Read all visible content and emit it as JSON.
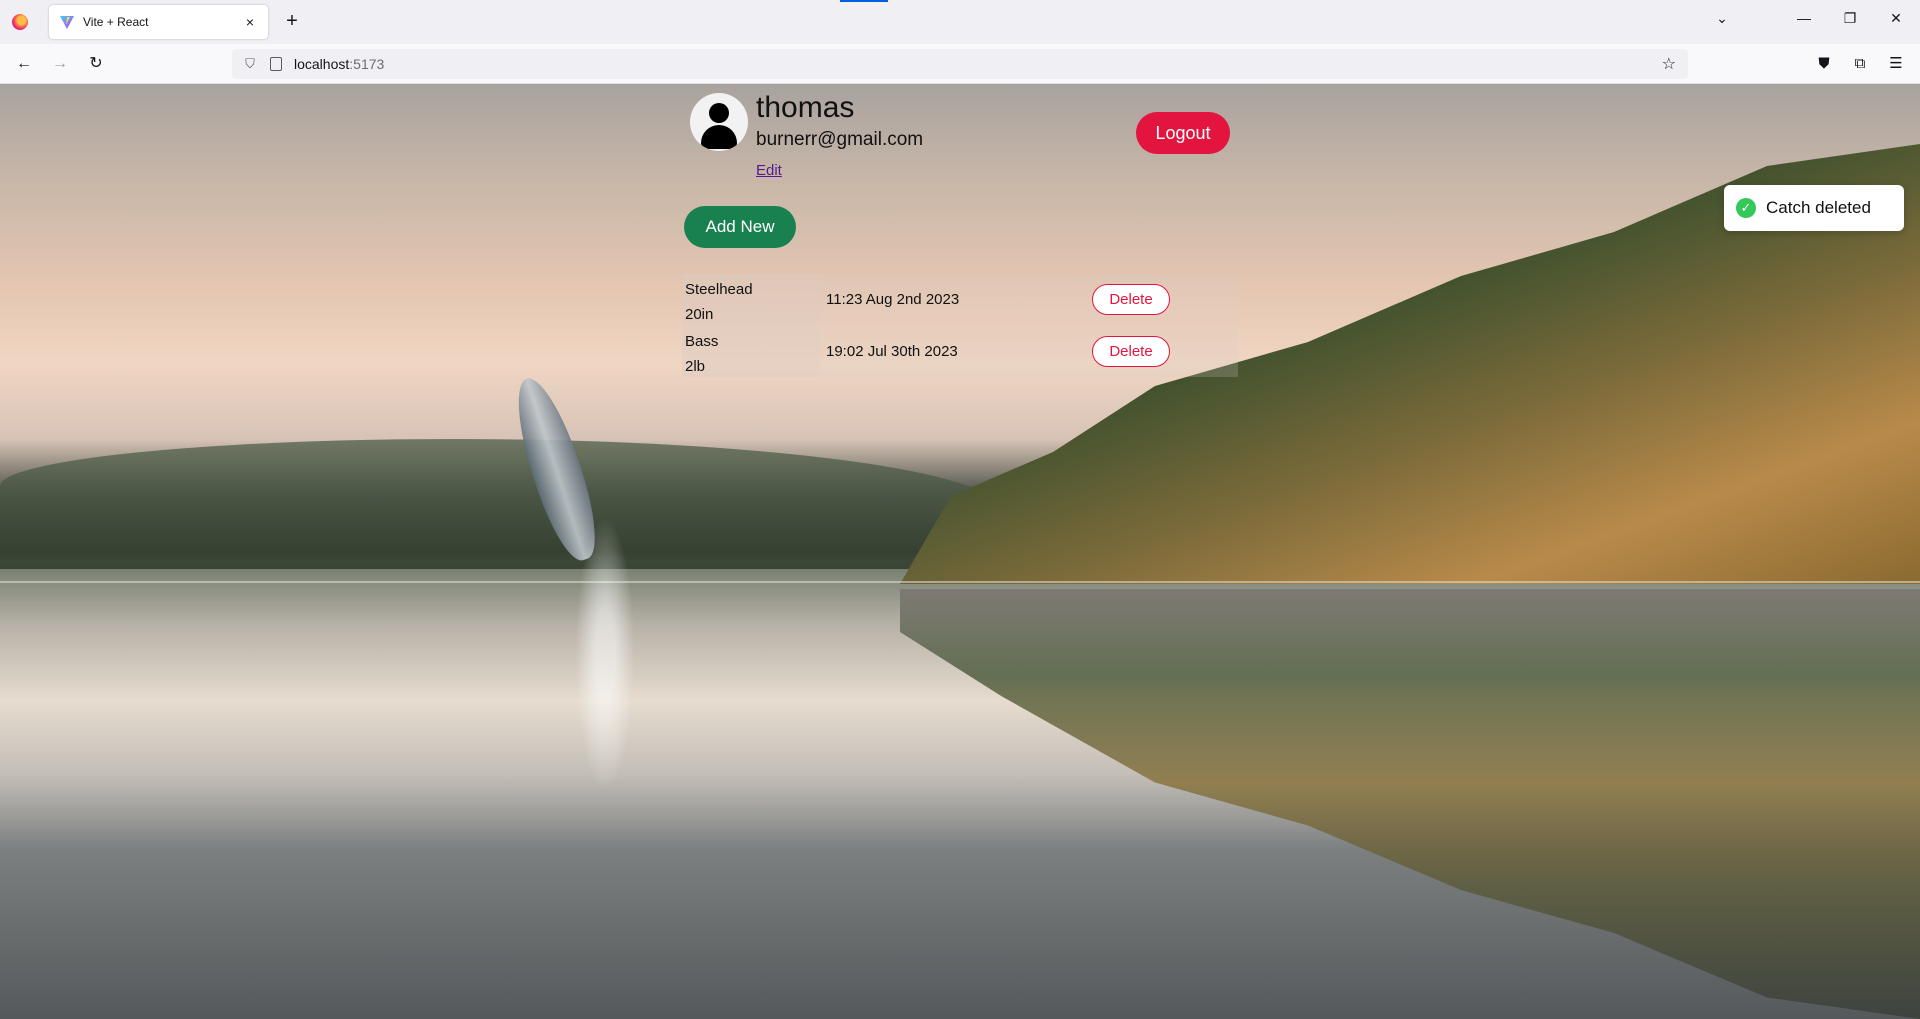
{
  "browser": {
    "tab_title": "Vite + React",
    "tab_close": "×",
    "new_tab": "+",
    "url_host": "localhost",
    "url_port": ":5173"
  },
  "profile": {
    "username": "thomas",
    "email": "burnerr@gmail.com",
    "edit_label": "Edit"
  },
  "actions": {
    "logout_label": "Logout",
    "add_new_label": "Add New"
  },
  "catches": [
    {
      "species": "Steelhead",
      "size": "20in",
      "time": "11:23 Aug 2nd 2023",
      "delete_label": "Delete"
    },
    {
      "species": "Bass",
      "size": "2lb",
      "time": "19:02 Jul 30th 2023",
      "delete_label": "Delete"
    }
  ],
  "toast": {
    "message": "Catch deleted"
  },
  "colors": {
    "logout_bg": "#e3153f",
    "add_new_bg": "#19804f",
    "toast_check": "#34c759"
  },
  "icons": [
    "firefox-icon",
    "vite-favicon-icon",
    "back-arrow-icon",
    "forward-arrow-icon",
    "reload-icon",
    "tracking-shield-icon",
    "page-icon",
    "bookmark-star-icon",
    "pocket-icon",
    "extensions-icon",
    "menu-icon",
    "avatar-icon",
    "check-circle-icon"
  ]
}
